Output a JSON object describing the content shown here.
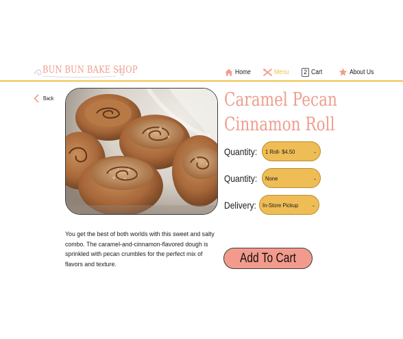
{
  "header": {
    "logo_text": "BUN BUN BAKE SHOP",
    "nav": {
      "home": "Home",
      "menu": "Menu",
      "cart_count": "2",
      "cart": "Cart",
      "about": "About Us"
    },
    "colors": {
      "accent": "#f0c24a",
      "brand": "#ef9d8e",
      "menu_active": "#f0c24a"
    }
  },
  "back_label": "Back",
  "product": {
    "title_line1": "Caramel Pecan",
    "title_line2": "Cinnamon Roll",
    "description": "You get the best of both worlds with this sweet and salty combo. The caramel-and-cinnamon-flavored dough is sprinkled with pecan crumbles for the perfect mix of flavors and texture."
  },
  "options": [
    {
      "label": "Quantity:",
      "value": "1 Roll- $4.50"
    },
    {
      "label": "Quantity:",
      "value": "None"
    },
    {
      "label": "Delivery:",
      "value": "In-Store Pickup"
    }
  ],
  "add_to_cart_label": "Add To Cart",
  "icons": {
    "home": "house-icon",
    "menu": "utensils-icon",
    "about": "star-icon",
    "back": "chevron-left-icon",
    "dropdown": "chevron-down-icon"
  }
}
